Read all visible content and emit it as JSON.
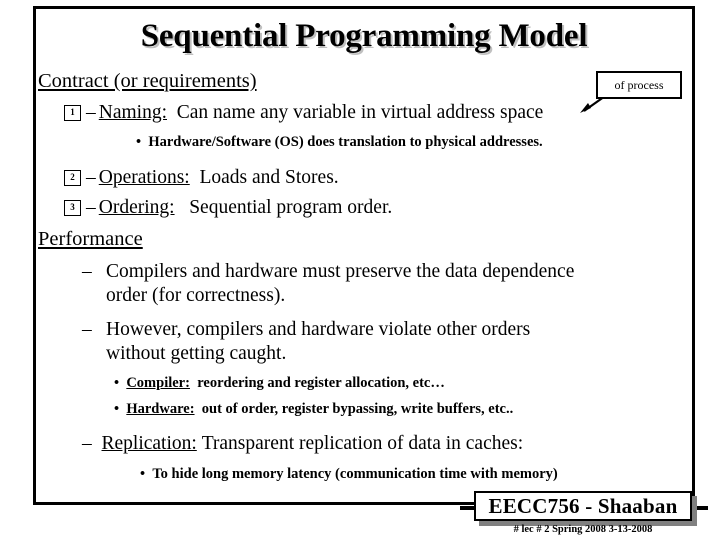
{
  "slide": {
    "title": "Sequential Programming Model",
    "callout": {
      "text": "of process"
    },
    "sections": [
      {
        "heading": "Contract (or requirements)",
        "items": [
          {
            "number": "1",
            "dash": "–",
            "term": "Naming:",
            "text": "Can name any variable in virtual address space",
            "subs": [
              "Hardware/Software (OS) does translation to physical addresses."
            ]
          },
          {
            "number": "2",
            "dash": "–",
            "term": "Operations:",
            "text": "Loads and Stores.",
            "subs": []
          },
          {
            "number": "3",
            "dash": "–",
            "term": "Ordering:",
            "text": "Sequential program order.",
            "subs": []
          }
        ]
      },
      {
        "heading": "Performance",
        "items": [
          {
            "dash": "–",
            "line1": "Compilers and hardware  must preserve the data dependence",
            "line2": "order (for correctness)."
          },
          {
            "dash": "–",
            "line1": "However, compilers and hardware violate other orders",
            "line2": "without getting caught."
          }
        ],
        "subs": [
          {
            "bullet": "•",
            "term": "Compiler:",
            "text": "reordering and register allocation, etc…"
          },
          {
            "bullet": "•",
            "term": "Hardware:",
            "text": "out of order, register bypassing, write buffers, etc.."
          }
        ],
        "replication": {
          "dash": "–",
          "term": "Replication:",
          "text": "Transparent replication of data in caches:",
          "sub": "To hide long memory latency (communication time with memory)"
        }
      }
    ]
  },
  "footer": {
    "title": "EECC756 - Shaaban",
    "subtitle": "#  lec # 2    Spring 2008   3-13-2008"
  },
  "colors": {
    "ink": "#000000",
    "paper": "#ffffff",
    "shadow": "#808080"
  }
}
